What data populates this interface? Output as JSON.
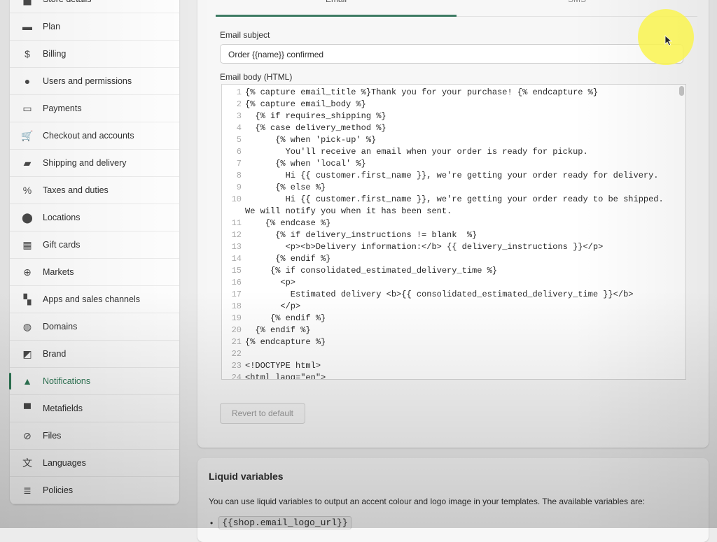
{
  "sidebar": {
    "active": "Notifications",
    "accent": "#2f7a57",
    "items": [
      {
        "label": "Store details",
        "icon": "store-icon"
      },
      {
        "label": "Plan",
        "icon": "plan-icon"
      },
      {
        "label": "Billing",
        "icon": "billing-icon"
      },
      {
        "label": "Users and permissions",
        "icon": "user-icon"
      },
      {
        "label": "Payments",
        "icon": "payments-icon"
      },
      {
        "label": "Checkout and accounts",
        "icon": "cart-icon"
      },
      {
        "label": "Shipping and delivery",
        "icon": "truck-icon"
      },
      {
        "label": "Taxes and duties",
        "icon": "tax-icon"
      },
      {
        "label": "Locations",
        "icon": "location-pin-icon"
      },
      {
        "label": "Gift cards",
        "icon": "gift-icon"
      },
      {
        "label": "Markets",
        "icon": "globe-icon"
      },
      {
        "label": "Apps and sales channels",
        "icon": "apps-icon"
      },
      {
        "label": "Domains",
        "icon": "domain-globe-icon"
      },
      {
        "label": "Brand",
        "icon": "brand-icon"
      },
      {
        "label": "Notifications",
        "icon": "bell-icon"
      },
      {
        "label": "Metafields",
        "icon": "metafields-icon"
      },
      {
        "label": "Files",
        "icon": "paperclip-icon"
      },
      {
        "label": "Languages",
        "icon": "translate-icon"
      },
      {
        "label": "Policies",
        "icon": "policy-icon"
      }
    ]
  },
  "main": {
    "tabs": [
      {
        "label": "Email",
        "active": true
      },
      {
        "label": "SMS",
        "active": false
      }
    ],
    "subject_label": "Email subject",
    "subject_value": "Order {{name}} confirmed",
    "body_label": "Email body (HTML)",
    "code_lines": [
      {
        "n": "1",
        "t": "{% capture email_title %}Thank you for your purchase! {% endcapture %}"
      },
      {
        "n": "2",
        "t": "{% capture email_body %}"
      },
      {
        "n": "3",
        "t": "  {% if requires_shipping %}"
      },
      {
        "n": "4",
        "t": "  {% case delivery_method %}"
      },
      {
        "n": "5",
        "t": "      {% when 'pick-up' %}"
      },
      {
        "n": "6",
        "t": "        You'll receive an email when your order is ready for pickup."
      },
      {
        "n": "7",
        "t": "      {% when 'local' %}"
      },
      {
        "n": "8",
        "t": "        Hi {{ customer.first_name }}, we're getting your order ready for delivery."
      },
      {
        "n": "9",
        "t": "      {% else %}"
      },
      {
        "n": "10",
        "t": "        Hi {{ customer.first_name }}, we're getting your order ready to be shipped."
      },
      {
        "n": "",
        "t": "We will notify you when it has been sent."
      },
      {
        "n": "11",
        "t": "    {% endcase %}"
      },
      {
        "n": "12",
        "t": "      {% if delivery_instructions != blank  %}"
      },
      {
        "n": "13",
        "t": "        <p><b>Delivery information:</b> {{ delivery_instructions }}</p>"
      },
      {
        "n": "14",
        "t": "      {% endif %}"
      },
      {
        "n": "15",
        "t": "     {% if consolidated_estimated_delivery_time %}"
      },
      {
        "n": "16",
        "t": "       <p>"
      },
      {
        "n": "17",
        "t": "         Estimated delivery <b>{{ consolidated_estimated_delivery_time }}</b>"
      },
      {
        "n": "18",
        "t": "       </p>"
      },
      {
        "n": "19",
        "t": "     {% endif %}"
      },
      {
        "n": "20",
        "t": "  {% endif %}"
      },
      {
        "n": "21",
        "t": "{% endcapture %}"
      },
      {
        "n": "22",
        "t": ""
      },
      {
        "n": "23",
        "t": "<!DOCTYPE html>"
      },
      {
        "n": "24",
        "t": "<html lang=\"en\">"
      }
    ],
    "revert_label": "Revert to default"
  },
  "liquid": {
    "title": "Liquid variables",
    "description": "You can use liquid variables to output an accent colour and logo image in your templates. The available variables are:",
    "variables": [
      "{{shop.email_logo_url}}"
    ]
  }
}
